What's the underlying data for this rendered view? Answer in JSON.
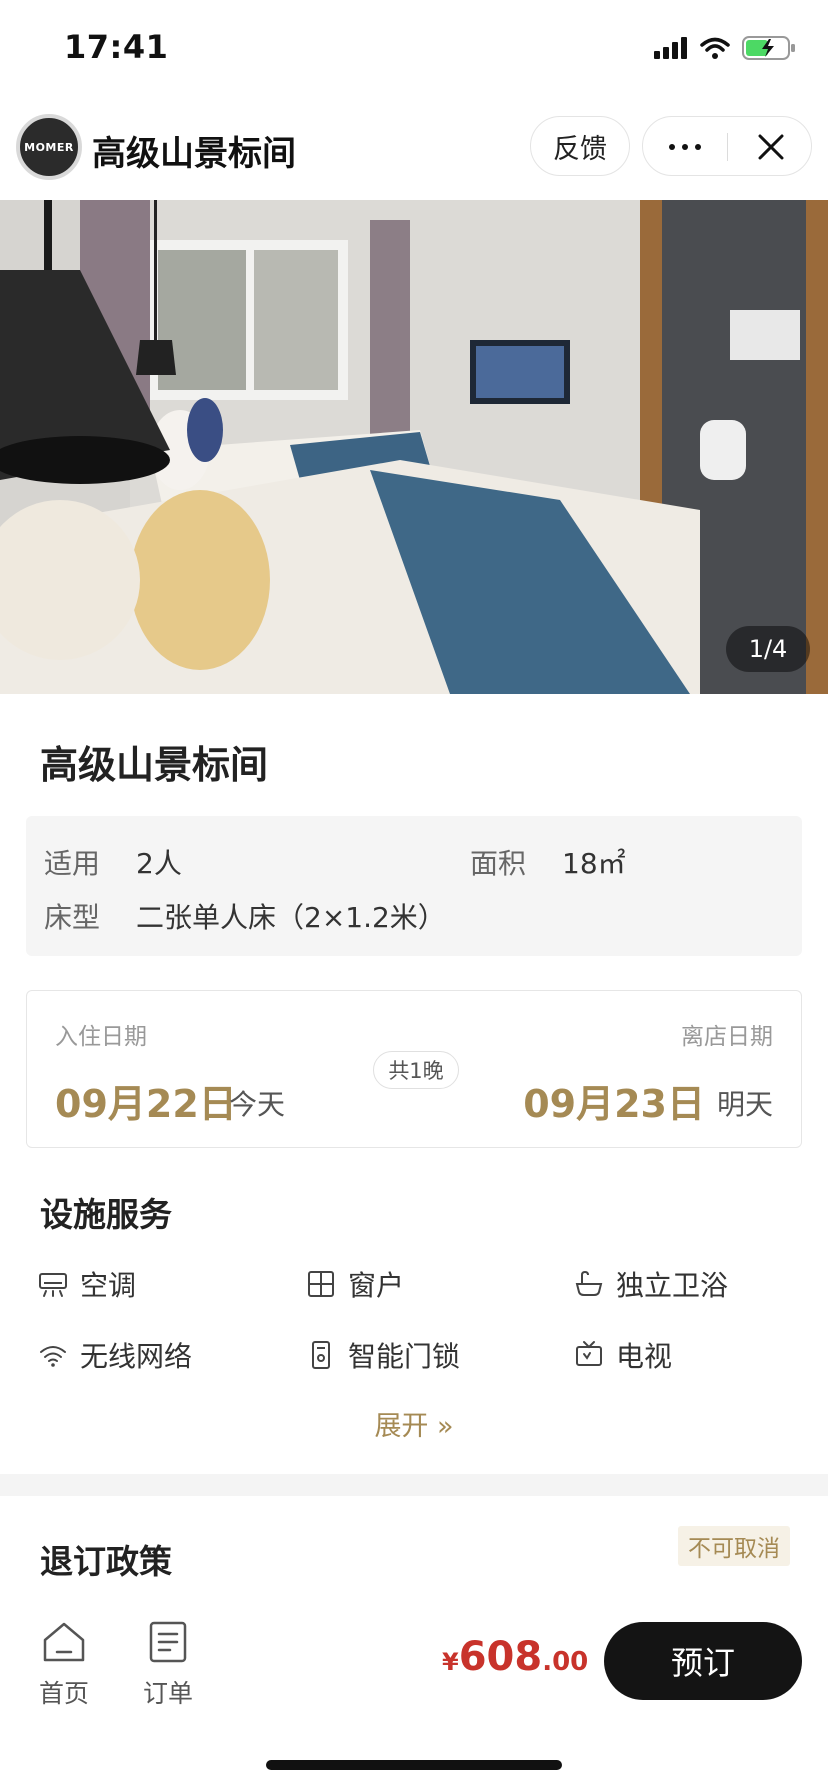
{
  "status_bar": {
    "time": "17:41"
  },
  "header": {
    "logo_text": "MOMER",
    "title": "高级山景标间",
    "feedback_label": "反馈"
  },
  "gallery": {
    "counter": "1/4"
  },
  "room": {
    "title": "高级山景标间",
    "capacity_label": "适用",
    "capacity_value": "2人",
    "area_label": "面积",
    "area_value": "18㎡",
    "bed_label": "床型",
    "bed_value": "二张单人床（2×1.2米）"
  },
  "dates": {
    "checkin_label": "入住日期",
    "checkin_value": "09月22日",
    "checkin_relative": "今天",
    "checkout_label": "离店日期",
    "checkout_value": "09月23日",
    "checkout_relative": "明天",
    "nights": "共1晚"
  },
  "facilities": {
    "title": "设施服务",
    "items": [
      {
        "label": "空调",
        "icon": "air-conditioner-icon"
      },
      {
        "label": "窗户",
        "icon": "window-icon"
      },
      {
        "label": "独立卫浴",
        "icon": "bathtub-icon"
      },
      {
        "label": "无线网络",
        "icon": "wifi-icon"
      },
      {
        "label": "智能门锁",
        "icon": "smart-lock-icon"
      },
      {
        "label": "电视",
        "icon": "tv-icon"
      }
    ],
    "expand_label": "展开 »"
  },
  "policy": {
    "title": "退订政策",
    "badge": "不可取消"
  },
  "bottom": {
    "home_label": "首页",
    "orders_label": "订单",
    "price_symbol": "¥",
    "price_integer": "608",
    "price_decimal": ".00",
    "book_label": "预订"
  },
  "colors": {
    "accent_gold": "#a58a54",
    "price_red": "#c8332b",
    "button_dark": "#141414",
    "battery_green": "#4cd964"
  }
}
